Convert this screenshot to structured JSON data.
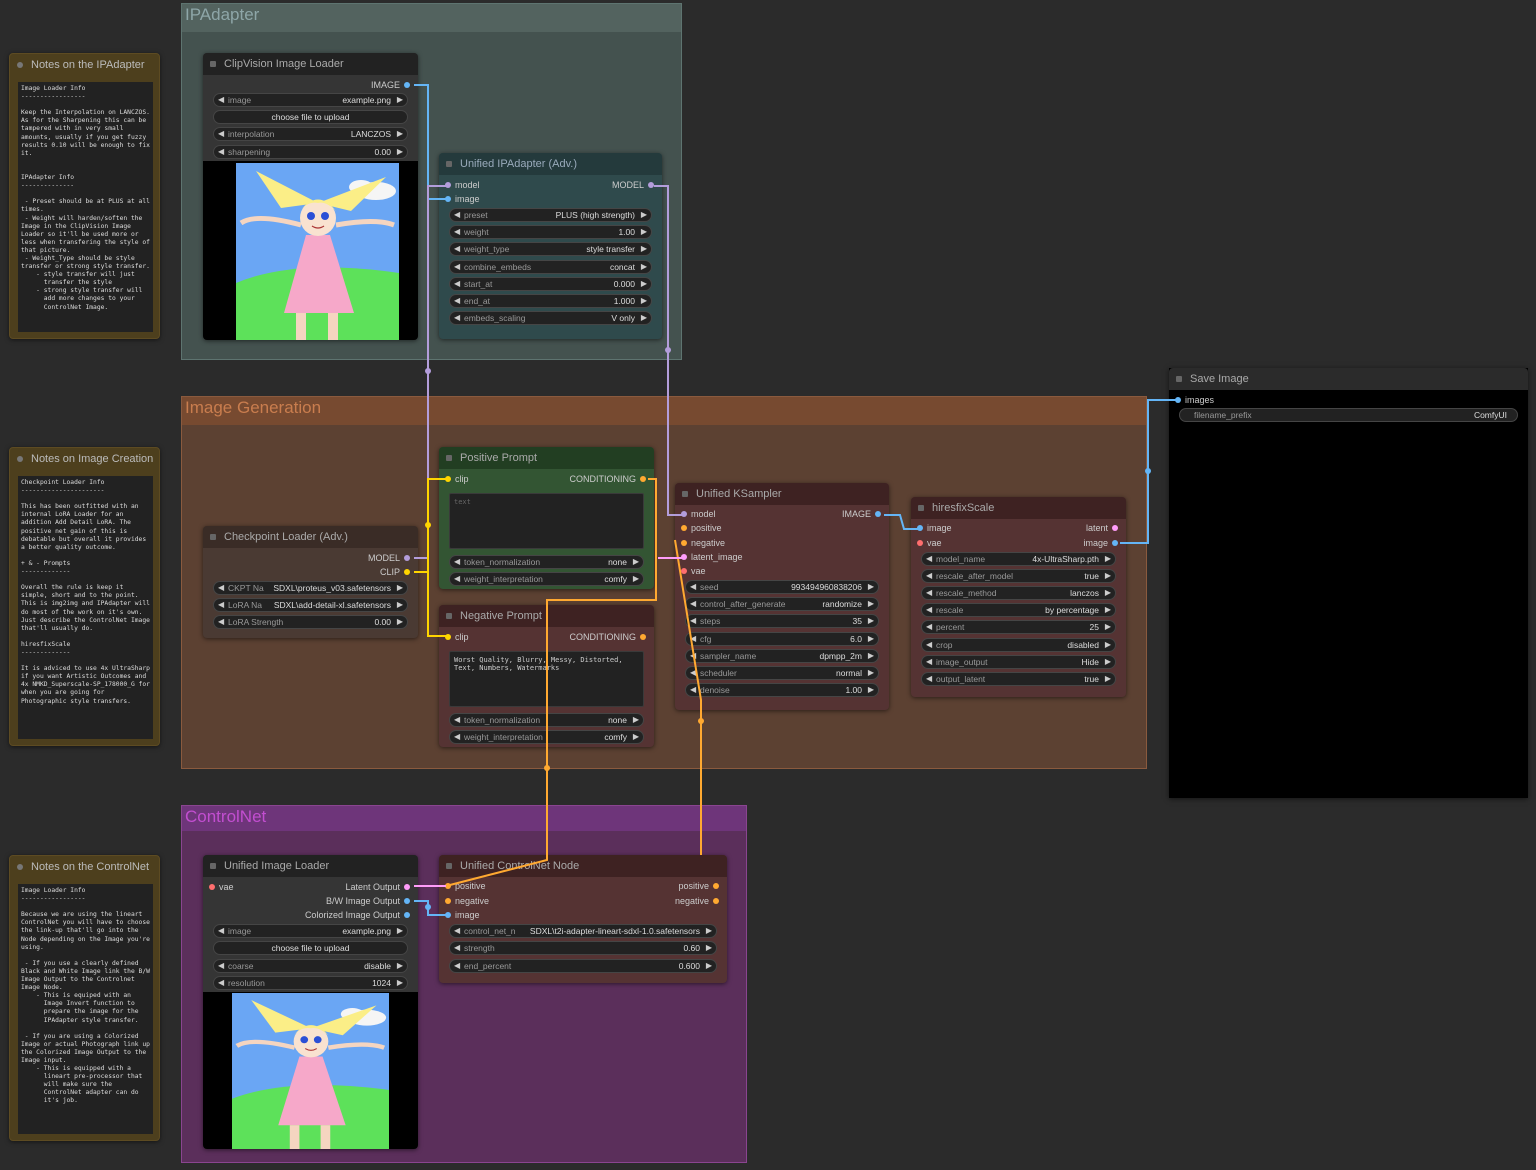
{
  "groups": {
    "ipadapter": "IPAdapter",
    "image_generation": "Image Generation",
    "controlnet": "ControlNet"
  },
  "notes": {
    "ipadapter": {
      "title": "Notes on the IPAdapter",
      "text": "Image Loader Info\n-----------------\n\nKeep the Interpolation on LANCZOS. As for the Sharpening this can be tampered with in very small amounts, usually if you get fuzzy results 0.10 will be enough to fix it.\n\n\nIPAdapter Info\n--------------\n\n - Preset should be at PLUS at all times.\n - Weight will harden/soften the Image in the ClipVision Image Loader so it'll be used more or less when transfering the style of that picture.\n - Weight_Type should be style transfer or strong style transfer.\n    - style transfer will just\n      transfer the style\n    - strong style transfer will\n      add more changes to your\n      ControlNet Image."
    },
    "image_creation": {
      "title": "Notes on Image Creation",
      "text": "Checkpoint Loader Info\n----------------------\n\nThis has been outfitted with an internal LoRA Loader for an addition Add Detail LoRA. The positive net gain of this is debatable but overall it provides a better quality outcome.\n\n+ & - Prompts\n-------------\n\nOverall the rule is keep it simple, short and to the point. This is img2img and IPAdapter will do most of the work on it's own. Just describe the ControlNet Image that'll usually do.\n\nhiresfixScale\n-------------\n\nIt is adviced to use 4x UltraSharp if you want Artistic Outcomes and 4x NMKD_Superscale-SP_178000_G for when you are going for Photographic style transfers."
    },
    "controlnet": {
      "title": "Notes on the ControlNet",
      "text": "Image Loader Info\n-----------------\n\nBecause we are using the lineart ControlNet you will have to choose the link-up that'll go into the Node depending on the Image you're using.\n\n - If you use a clearly defined Black and White Image link the B/W Image Output to the Controlnet Image Node.\n    - This is equiped with an\n      Image Invert function to\n      prepare the image for the\n      IPAdapter style transfer.\n\n - If you are using a Colorized Image or actual Photograph link up the Colorized Image Output to the Image input.\n    - This is equipped with a\n      lineart pre-processor that\n      will make sure the\n      ControlNet adapter can do\n      it's job."
    }
  },
  "clipvision": {
    "title": "ClipVision Image Loader",
    "output": "IMAGE",
    "image": {
      "label": "image",
      "value": "example.png"
    },
    "upload": "choose file to upload",
    "interpolation": {
      "label": "interpolation",
      "value": "LANCZOS"
    },
    "sharpening": {
      "label": "sharpening",
      "value": "0.00"
    }
  },
  "ipadapter": {
    "title": "Unified IPAdapter (Adv.)",
    "in_model": "model",
    "in_image": "image",
    "out_model": "MODEL",
    "widgets": [
      {
        "label": "preset",
        "value": "PLUS (high strength)"
      },
      {
        "label": "weight",
        "value": "1.00"
      },
      {
        "label": "weight_type",
        "value": "style transfer"
      },
      {
        "label": "combine_embeds",
        "value": "concat"
      },
      {
        "label": "start_at",
        "value": "0.000"
      },
      {
        "label": "end_at",
        "value": "1.000"
      },
      {
        "label": "embeds_scaling",
        "value": "V only"
      }
    ]
  },
  "checkpoint": {
    "title": "Checkpoint Loader (Adv.)",
    "out_model": "MODEL",
    "out_clip": "CLIP",
    "ckpt": {
      "label": "CKPT Na",
      "value": "SDXL\\proteus_v03.safetensors"
    },
    "lora": {
      "label": "LoRA Na",
      "value": "SDXL\\add-detail-xl.safetensors"
    },
    "strength": {
      "label": "LoRA Strength",
      "value": "0.00"
    }
  },
  "positive": {
    "title": "Positive Prompt",
    "in_clip": "clip",
    "out": "CONDITIONING",
    "placeholder": "text",
    "token_normalization": {
      "label": "token_normalization",
      "value": "none"
    },
    "weight_interpretation": {
      "label": "weight_interpretation",
      "value": "comfy"
    }
  },
  "negative": {
    "title": "Negative Prompt",
    "in_clip": "clip",
    "out": "CONDITIONING",
    "text": "Worst Quality, Blurry, Messy, Distorted, Text, Numbers, Watermarks",
    "token_normalization": {
      "label": "token_normalization",
      "value": "none"
    },
    "weight_interpretation": {
      "label": "weight_interpretation",
      "value": "comfy"
    }
  },
  "ksampler": {
    "title": "Unified KSampler",
    "inputs": [
      "model",
      "positive",
      "negative",
      "latent_image",
      "vae"
    ],
    "out": "IMAGE",
    "widgets": [
      {
        "label": "seed",
        "value": "993494960838206"
      },
      {
        "label": "control_after_generate",
        "value": "randomize"
      },
      {
        "label": "steps",
        "value": "35"
      },
      {
        "label": "cfg",
        "value": "6.0"
      },
      {
        "label": "sampler_name",
        "value": "dpmpp_2m"
      },
      {
        "label": "scheduler",
        "value": "normal"
      },
      {
        "label": "denoise",
        "value": "1.00"
      }
    ]
  },
  "hiresfix": {
    "title": "hiresfixScale",
    "in_image": "image",
    "in_vae": "vae",
    "out_latent": "latent",
    "out_image": "image",
    "widgets": [
      {
        "label": "model_name",
        "value": "4x-UltraSharp.pth"
      },
      {
        "label": "rescale_after_model",
        "value": "true"
      },
      {
        "label": "rescale_method",
        "value": "lanczos"
      },
      {
        "label": "rescale",
        "value": "by percentage"
      },
      {
        "label": "percent",
        "value": "25"
      },
      {
        "label": "crop",
        "value": "disabled"
      },
      {
        "label": "image_output",
        "value": "Hide"
      },
      {
        "label": "output_latent",
        "value": "true"
      }
    ]
  },
  "save": {
    "title": "Save Image",
    "in_images": "images",
    "filename_prefix": {
      "label": "filename_prefix",
      "value": "ComfyUI"
    }
  },
  "imageloader": {
    "title": "Unified Image Loader",
    "in_vae": "vae",
    "outputs": [
      "Latent Output",
      "B/W Image Output",
      "Colorized Image Output"
    ],
    "image": {
      "label": "image",
      "value": "example.png"
    },
    "upload": "choose file to upload",
    "coarse": {
      "label": "coarse",
      "value": "disable"
    },
    "resolution": {
      "label": "resolution",
      "value": "1024"
    }
  },
  "controlnet": {
    "title": "Unified ControlNet Node",
    "inputs": [
      "positive",
      "negative",
      "image"
    ],
    "outputs": [
      "positive",
      "negative"
    ],
    "control_net": {
      "label": "control_net_n",
      "value": "SDXL\\t2i-adapter-lineart-sdxl-1.0.safetensors"
    },
    "strength": {
      "label": "strength",
      "value": "0.60"
    },
    "end_percent": {
      "label": "end_percent",
      "value": "0.600"
    }
  },
  "colors": {
    "group_ipadapter": "#44524f",
    "group_generation": "#5c4132",
    "group_controlnet": "#5b2f5b",
    "note": "#4d3f1d",
    "wire_model": "#b39ddb",
    "wire_clip": "#ffd500",
    "wire_image": "#64b5f6",
    "wire_conditioning": "#ffa931",
    "wire_latent": "#ff9cf9"
  },
  "icons": {
    "node_collapse": "square-icon",
    "note_collapse": "circle-icon",
    "widget_decrement": "left-arrow-icon",
    "widget_increment": "right-arrow-icon"
  }
}
